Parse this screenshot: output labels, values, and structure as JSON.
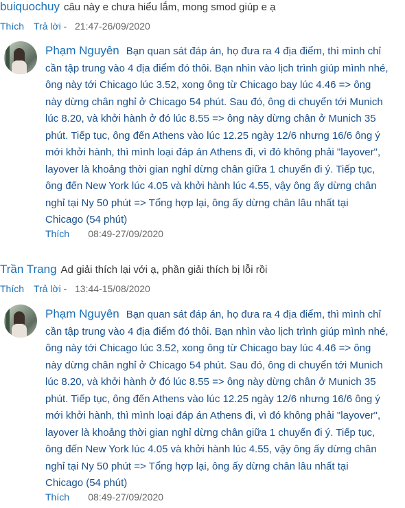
{
  "comments": [
    {
      "user": "buiquochuy",
      "text": "câu này e chưa hiểu lắm, mong smod giúp e ạ",
      "like": "Thích",
      "reply": "Trả lời -",
      "time": "21:47-26/09/2020",
      "answer": {
        "user": "Phạm Nguyên",
        "text": "Bạn quan sát đáp án, họ đưa ra 4 địa điểm, thì mình chỉ cần tập trung vào 4 địa điểm đó thôi. Bạn nhìn vào lịch trình giúp mình nhé, ông này tới Chicago lúc 3.52, xong ông từ Chicago bay lúc 4.46 => ông này dừng chân nghỉ ở Chicago 54 phút. Sau đó, ông di chuyển tới Munich lúc 8.20, và khởi hành ở đó lúc 8.55 => ông này dừng chân ở Munich 35 phút. Tiếp tục, ông đến Athens vào lúc 12.25 ngày 12/6 nhưng 16/6 ông ý mới khởi hành, thì mình loại đáp án Athens đi, vì đó không phải \"layover\", layover là khoảng thời gian nghỉ dừng chân giữa 1 chuyến đi ý. Tiếp tục, ông đến New York lúc 4.05 và khởi hành lúc 4.55, vậy ông ấy dừng chân nghỉ tại Ny 50 phút => Tổng hợp lại, ông ấy dừng chân lâu nhất tại Chicago (54 phút)",
        "like": "Thích",
        "time": "08:49-27/09/2020"
      }
    },
    {
      "user": "Trần Trang",
      "text": "Ad giải thích lại với ạ, phần giải thích bị lỗi rồi",
      "like": "Thích",
      "reply": "Trả lời -",
      "time": "13:44-15/08/2020",
      "answer": {
        "user": "Phạm Nguyên",
        "text": "Bạn quan sát đáp án, họ đưa ra 4 địa điểm, thì mình chỉ cần tập trung vào 4 địa điểm đó thôi. Bạn nhìn vào lịch trình giúp mình nhé, ông này tới Chicago lúc 3.52, xong ông từ Chicago bay lúc 4.46 => ông này dừng chân nghỉ ở Chicago 54 phút. Sau đó, ông di chuyển tới Munich lúc 8.20, và khởi hành ở đó lúc 8.55 => ông này dừng chân ở Munich 35 phút. Tiếp tục, ông đến Athens vào lúc 12.25 ngày 12/6 nhưng 16/6 ông ý mới khởi hành, thì mình loại đáp án Athens đi, vì đó không phải \"layover\", layover là khoảng thời gian nghỉ dừng chân giữa 1 chuyến đi ý. Tiếp tục, ông đến New York lúc 4.05 và khởi hành lúc 4.55, vậy ông ấy dừng chân nghỉ tại Ny 50 phút => Tổng hợp lại, ông ấy dừng chân lâu nhất tại Chicago (54 phút)",
        "like": "Thích",
        "time": "08:49-27/09/2020"
      }
    }
  ]
}
